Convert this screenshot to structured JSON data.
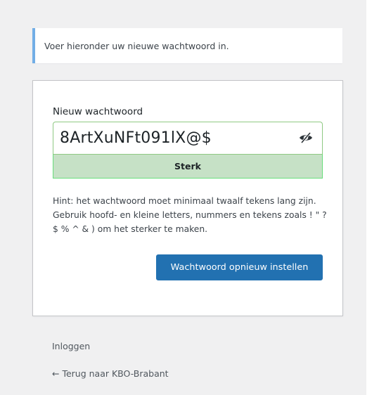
{
  "notice": {
    "message": "Voer hieronder uw nieuwe wachtwoord in."
  },
  "form": {
    "password_label": "Nieuw wachtwoord",
    "password_value": "8ArtXuNFt091lX@$",
    "toggle_icon": "eye-slash-icon",
    "strength_label": "Sterk",
    "hint": "Hint: het wachtwoord moet minimaal twaalf tekens lang zijn. Gebruik hoofd- en kleine letters, nummers en tekens zoals ! \" ? $ % ^ & ) om het sterker te maken.",
    "submit_label": "Wachtwoord opnieuw instellen"
  },
  "nav": {
    "login_label": "Inloggen",
    "back_label": "← Terug naar KBO-Brabant"
  },
  "colors": {
    "primary": "#2271b1",
    "notice_border": "#72aee6",
    "strength_strong_bg": "#c6e1c6",
    "strength_strong_border": "#68de7c"
  }
}
